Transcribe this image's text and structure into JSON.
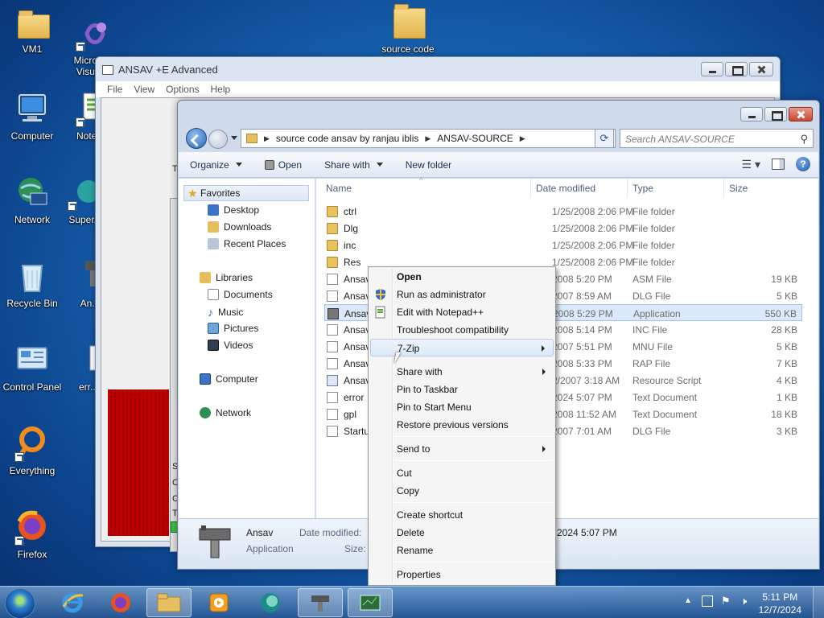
{
  "desktop": {
    "icons": [
      {
        "label": "VM1"
      },
      {
        "label": "Microsoft Visual..."
      },
      {
        "label": "source code"
      },
      {
        "label": "Computer"
      },
      {
        "label": "Notep..."
      },
      {
        "label": "Network"
      },
      {
        "label": "Super..."
      },
      {
        "label": "Recycle Bin"
      },
      {
        "label": "An..."
      },
      {
        "label": "Control Panel"
      },
      {
        "label": "err..."
      },
      {
        "label": "Everything"
      },
      {
        "label": "Firefox"
      }
    ]
  },
  "ansav_window": {
    "title": "ANSAV +E Advanced",
    "menu": [
      "File",
      "View",
      "Options",
      "Help"
    ],
    "side_texts": [
      "T",
      "Sta",
      "C:\\",
      "Che",
      "Thr"
    ]
  },
  "explorer": {
    "address_parts": [
      "source code ansav by ranjau iblis",
      "ANSAV-SOURCE"
    ],
    "search_placeholder": "Search ANSAV-SOURCE",
    "toolbar": {
      "organize": "Organize",
      "open": "Open",
      "share_with": "Share with",
      "new_folder": "New folder"
    },
    "nav": {
      "favorites": "Favorites",
      "favorites_items": [
        "Desktop",
        "Downloads",
        "Recent Places"
      ],
      "libraries": "Libraries",
      "libraries_items": [
        "Documents",
        "Music",
        "Pictures",
        "Videos"
      ],
      "computer": "Computer",
      "network": "Network"
    },
    "columns": {
      "name": "Name",
      "date": "Date modified",
      "type": "Type",
      "size": "Size"
    },
    "files": [
      {
        "name": "ctrl",
        "date": "1/25/2008 2:06 PM",
        "type": "File folder",
        "size": "",
        "icon": "folder"
      },
      {
        "name": "Dlg",
        "date": "1/25/2008 2:06 PM",
        "type": "File folder",
        "size": "",
        "icon": "folder"
      },
      {
        "name": "inc",
        "date": "1/25/2008 2:06 PM",
        "type": "File folder",
        "size": "",
        "icon": "folder"
      },
      {
        "name": "Res",
        "date": "1/25/2008 2:06 PM",
        "type": "File folder",
        "size": "",
        "icon": "folder"
      },
      {
        "name": "Ansav",
        "date": "2008 5:20 PM",
        "type": "ASM File",
        "size": "19 KB",
        "icon": "doc"
      },
      {
        "name": "Ansav",
        "date": "2007 8:59 AM",
        "type": "DLG File",
        "size": "5 KB",
        "icon": "doc"
      },
      {
        "name": "Ansav",
        "date": "2008 5:29 PM",
        "type": "Application",
        "size": "550 KB",
        "icon": "app"
      },
      {
        "name": "Ansav",
        "date": "2008 5:14 PM",
        "type": "INC File",
        "size": "28 KB",
        "icon": "doc"
      },
      {
        "name": "Ansav",
        "date": "2007 5:51 PM",
        "type": "MNU File",
        "size": "5 KB",
        "icon": "doc"
      },
      {
        "name": "Ansav",
        "date": "2008 5:33 PM",
        "type": "RAP File",
        "size": "7 KB",
        "icon": "doc"
      },
      {
        "name": "Ansav",
        "date": "2/2007 3:18 AM",
        "type": "Resource Script",
        "size": "4 KB",
        "icon": "res"
      },
      {
        "name": "error",
        "date": "2024 5:07 PM",
        "type": "Text Document",
        "size": "1 KB",
        "icon": "doc"
      },
      {
        "name": "gpl",
        "date": "2008 11:52 AM",
        "type": "Text Document",
        "size": "18 KB",
        "icon": "doc"
      },
      {
        "name": "Startu",
        "date": "2007 7:01 AM",
        "type": "DLG File",
        "size": "3 KB",
        "icon": "doc"
      }
    ],
    "details": {
      "name": "Ansav",
      "type": "Application",
      "date_label": "Date modified:",
      "size_label": "Size:",
      "date_value": "2024 5:07 PM"
    }
  },
  "context_menu": {
    "items": [
      {
        "label": "Open",
        "bold": true
      },
      {
        "label": "Run as administrator"
      },
      {
        "label": "Edit with Notepad++"
      },
      {
        "label": "Troubleshoot compatibility"
      },
      {
        "label": "7-Zip",
        "submenu": true
      },
      {
        "label": "Share with",
        "submenu": true
      },
      {
        "label": "Pin to Taskbar"
      },
      {
        "label": "Pin to Start Menu"
      },
      {
        "label": "Restore previous versions"
      },
      {
        "label": "Send to",
        "submenu": true
      },
      {
        "label": "Cut"
      },
      {
        "label": "Copy"
      },
      {
        "label": "Create shortcut"
      },
      {
        "label": "Delete"
      },
      {
        "label": "Rename"
      },
      {
        "label": "Properties"
      }
    ]
  },
  "taskbar": {
    "time": "5:11 PM",
    "date": "12/7/2024"
  }
}
